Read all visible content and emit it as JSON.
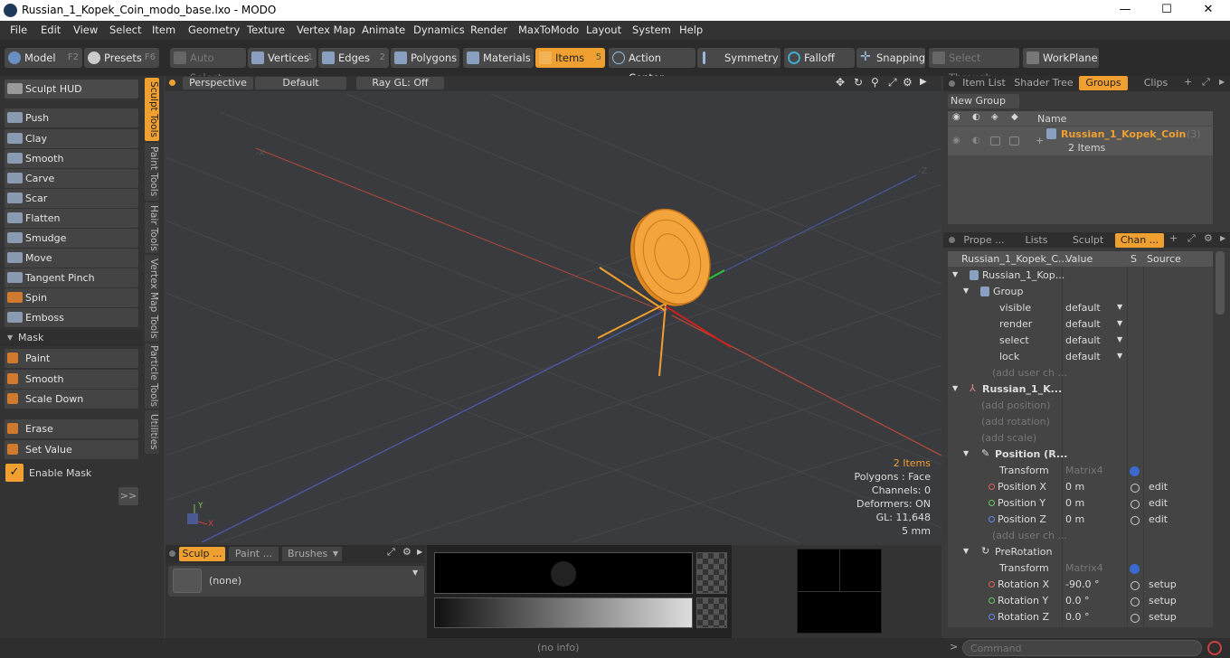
{
  "app": {
    "title": "Russian_1_Kopek_Coin_modo_base.lxo - MODO"
  },
  "window_controls": {
    "minimize": "—",
    "maximize": "☐",
    "close": "✕"
  },
  "menu": [
    "File",
    "Edit",
    "View",
    "Select",
    "Item",
    "Geometry",
    "Texture",
    "Vertex Map",
    "Animate",
    "Dynamics",
    "Render",
    "MaxToModo",
    "Layout",
    "System",
    "Help"
  ],
  "toolbar": {
    "model": "Model",
    "model_key": "F2",
    "presets": "Presets",
    "presets_key": "F6",
    "auto_select": "Auto Select",
    "vertices": "Vertices",
    "vertices_key": "1",
    "edges": "Edges",
    "edges_key": "2",
    "polygons": "Polygons",
    "materials": "Materials",
    "items": "Items",
    "items_key": "5",
    "action_center": "Action Center",
    "symmetry": "Symmetry",
    "falloff": "Falloff",
    "snapping": "Snapping",
    "select_through": "Select Through",
    "workplane": "WorkPlane"
  },
  "left": {
    "hud": "Sculpt HUD",
    "tools": [
      "Push",
      "Clay",
      "Smooth",
      "Carve",
      "Scar",
      "Flatten",
      "Smudge",
      "Move",
      "Tangent Pinch",
      "Spin",
      "Emboss"
    ],
    "mask_header": "Mask",
    "mask_tools": [
      "Paint",
      "Smooth",
      "Scale Down"
    ],
    "erase": "Erase",
    "set_value": "Set Value",
    "enable_mask": "Enable Mask",
    "expand": ">>"
  },
  "vtabs": [
    "Sculpt Tools",
    "Paint Tools",
    "Hair Tools",
    "Vertex Map Tools",
    "Particle Tools",
    "Utilities"
  ],
  "viewport": {
    "perspective": "Perspective",
    "default": "Default",
    "raygl": "Ray GL: Off",
    "hud": {
      "items": "2 Items",
      "polygons": "Polygons : Face",
      "channels": "Channels: 0",
      "deformers": "Deformers: ON",
      "gl": "GL: 11,648",
      "unit": "5 mm"
    }
  },
  "bottom": {
    "tab1": "Sculp ...",
    "tab2": "Paint ...",
    "tab3": "Brushes",
    "preset": "(none)"
  },
  "right": {
    "tabs": [
      "Item List",
      "Shader Tree",
      "Groups",
      "Clips"
    ],
    "new_group": "New Group",
    "groups_header": "Name",
    "group_name": "Russian_1_Kopek_Coin",
    "group_count": "(3)",
    "group_items": "2 Items",
    "tabs2": [
      "Prope ...",
      "Lists",
      "Sculpt",
      "Chan ..."
    ],
    "chan_headers": {
      "name": "Russian_1_Kopek_C...",
      "value": "Value",
      "s": "S",
      "source": "Source"
    },
    "rows": [
      {
        "name": "Russian_1_Kop...",
        "value": "",
        "src": ""
      },
      {
        "name": "Group",
        "value": "",
        "src": ""
      },
      {
        "name": "visible",
        "value": "default",
        "src": ""
      },
      {
        "name": "render",
        "value": "default",
        "src": ""
      },
      {
        "name": "select",
        "value": "default",
        "src": ""
      },
      {
        "name": "lock",
        "value": "default",
        "src": ""
      },
      {
        "name": "(add user ch ...",
        "value": "",
        "src": ""
      },
      {
        "name": "Russian_1_K...",
        "value": "",
        "src": ""
      },
      {
        "name": "(add position)",
        "value": "",
        "src": ""
      },
      {
        "name": "(add rotation)",
        "value": "",
        "src": ""
      },
      {
        "name": "(add scale)",
        "value": "",
        "src": ""
      },
      {
        "name": "Position (R...",
        "value": "",
        "src": ""
      },
      {
        "name": "Transform",
        "value": "Matrix4",
        "src": ""
      },
      {
        "name": "Position X",
        "value": "0 m",
        "src": "edit"
      },
      {
        "name": "Position Y",
        "value": "0 m",
        "src": "edit"
      },
      {
        "name": "Position Z",
        "value": "0 m",
        "src": "edit"
      },
      {
        "name": "(add user ch ...",
        "value": "",
        "src": ""
      },
      {
        "name": "PreRotation",
        "value": "",
        "src": ""
      },
      {
        "name": "Transform",
        "value": "Matrix4",
        "src": ""
      },
      {
        "name": "Rotation X",
        "value": "-90.0 °",
        "src": "setup"
      },
      {
        "name": "Rotation Y",
        "value": "0.0 °",
        "src": "setup"
      },
      {
        "name": "Rotation Z",
        "value": "0.0 °",
        "src": "setup"
      }
    ]
  },
  "status": {
    "info": "(no info)",
    "command_placeholder": "Command"
  },
  "colors": {
    "accent": "#f0a030",
    "panel": "#3a3a3a",
    "viewport": "#393b3e"
  }
}
